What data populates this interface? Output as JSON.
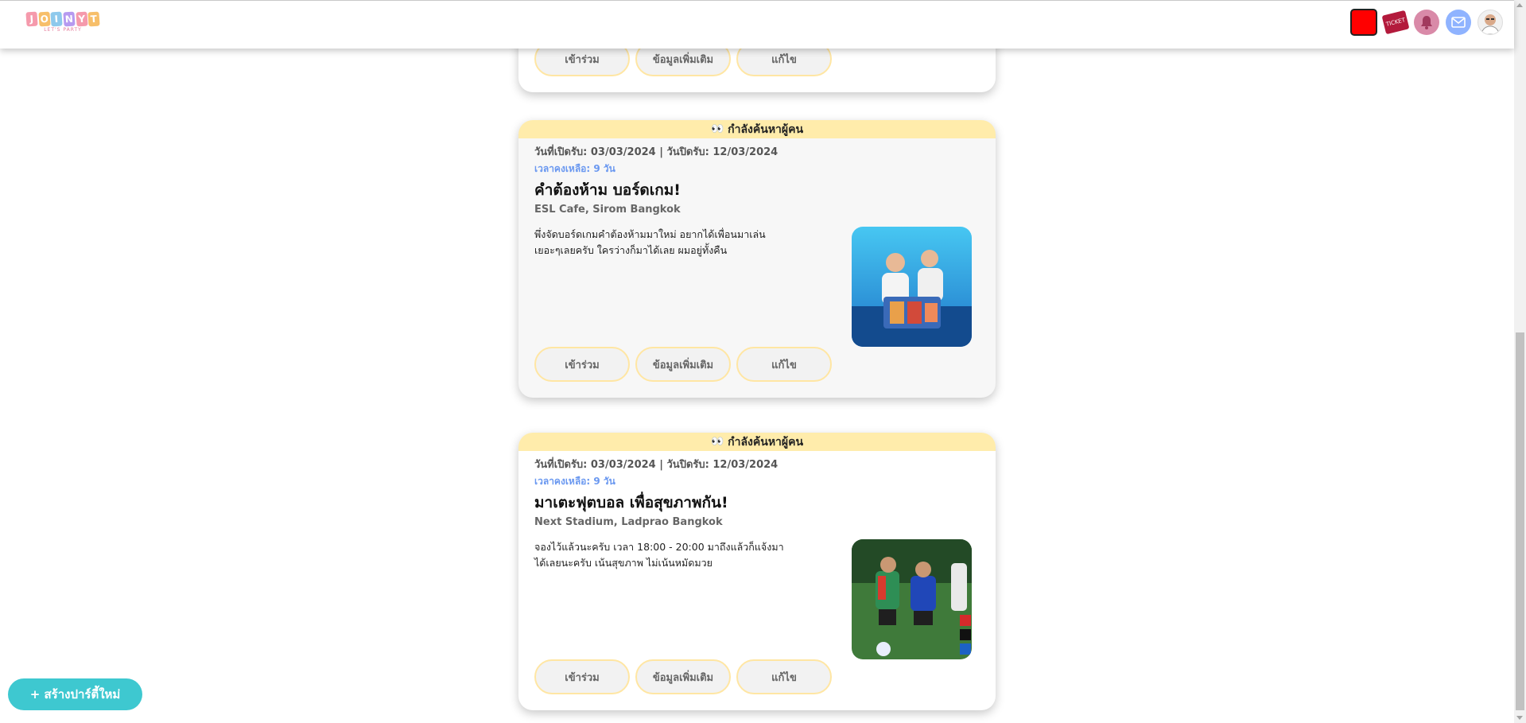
{
  "header": {
    "logo": {
      "letters": [
        "J",
        "O",
        "I",
        "N",
        "Y",
        "T"
      ],
      "subtitle": "LET'S PARTY",
      "colors": [
        "#f7a8b8",
        "#f9c97a",
        "#a8d8f0",
        "#c5a8f0",
        "#f7a8b8",
        "#f9c97a"
      ]
    },
    "icons": {
      "ticket_text": "TICKET"
    }
  },
  "buttons": {
    "join": "เข้าร่วม",
    "more_info": "ข้อมูลเพิ่มเติม",
    "edit": "แก้ไข"
  },
  "cards": [
    {
      "status": "กำลังค้นหาผู้คน",
      "dates": "วันที่เปิดรับ: 03/03/2024 | วันปิดรับ: 12/03/2024",
      "remaining": "เวลาคงเหลือ: 9 วัน",
      "title": "คำต้องห้าม บอร์ดเกม!",
      "location": "ESL Cafe, Sirom Bangkok",
      "description": "พึ่งจัดบอร์ดเกมคำต้องห้ามมาใหม่ อยากได้เพื่อนมาเล่นเยอะๆเลยครับ ใครว่างก็มาได้เลย ผมอยู่ทั้งคืน"
    },
    {
      "status": "กำลังค้นหาผู้คน",
      "dates": "วันที่เปิดรับ: 03/03/2024 | วันปิดรับ: 12/03/2024",
      "remaining": "เวลาคงเหลือ: 9 วัน",
      "title": "มาเตะฟุตบอล เพื่อสุขภาพกัน!",
      "location": "Next Stadium, Ladprao Bangkok",
      "description": "จองไว้แล้วนะครับ เวลา 18:00 - 20:00 มาถึงแล้วก็แจ้งมาได้เลยนะครับ เน้นสุขภาพ ไม่เน้นหมัดมวย"
    }
  ],
  "create_party": "+ สร้างปาร์ตี้ใหม่",
  "colors": {
    "status_bg": "#ffecab",
    "remaining": "#6a98f0",
    "create_btn": "#3ec8d0",
    "btn_border": "#ffe6a3"
  }
}
